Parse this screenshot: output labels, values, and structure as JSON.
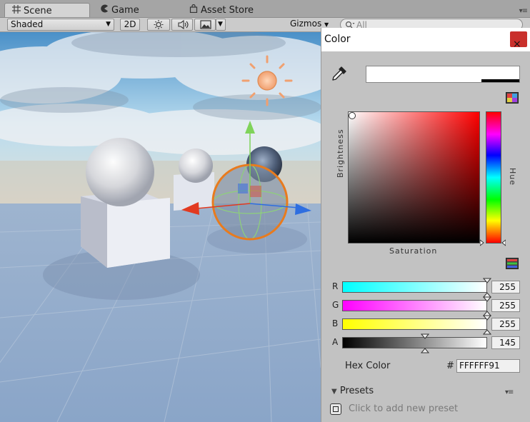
{
  "tabs": [
    {
      "icon": "scene-grid-icon",
      "label": "Scene"
    },
    {
      "icon": "game-pacman-icon",
      "label": "Game"
    },
    {
      "icon": "shopping-bag-icon",
      "label": "Asset Store"
    }
  ],
  "toolbar": {
    "shading_mode": "Shaded",
    "mode_2d": "2D",
    "gizmos_label": "Gizmos",
    "search_value": "All"
  },
  "color_picker": {
    "title": "Color",
    "close_symbol": "×",
    "brightness_label": "Brightness",
    "hue_label": "Hue",
    "saturation_label": "Saturation",
    "channels": [
      {
        "label": "R",
        "value": "255"
      },
      {
        "label": "G",
        "value": "255"
      },
      {
        "label": "B",
        "value": "255"
      },
      {
        "label": "A",
        "value": "145"
      }
    ],
    "hex_label": "Hex Color",
    "hex_prefix": "#",
    "hex_value": "FFFFFF91",
    "presets_label": "Presets",
    "add_preset_text": "Click to add new preset",
    "current_color": "#FFFFFF",
    "alpha_fraction": 0.569
  }
}
